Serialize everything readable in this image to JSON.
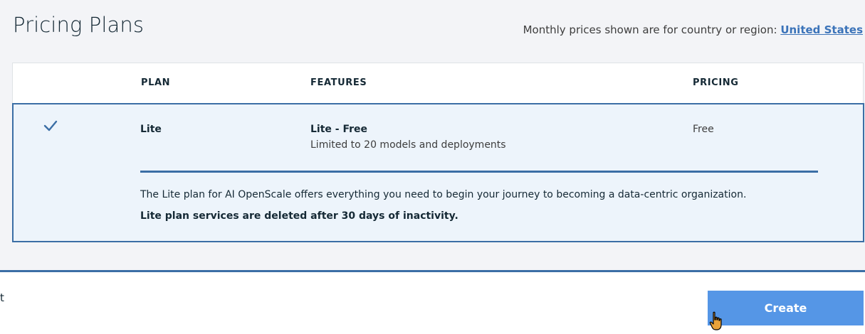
{
  "header": {
    "title": "Pricing Plans",
    "region_prefix": "Monthly prices shown are for country or region: ",
    "region_link": "United States"
  },
  "table": {
    "columns": [
      "PLAN",
      "FEATURES",
      "PRICING"
    ],
    "selected_plan": {
      "name": "Lite",
      "feature_title": "Lite - Free",
      "feature_detail": "Limited to 20 models and deployments",
      "price": "Free",
      "description": "The Lite plan for AI OpenScale offers everything you need to begin your journey to becoming a data-centric organization.",
      "inactivity_note": "Lite plan services are deleted after 30 days of inactivity."
    }
  },
  "footer": {
    "left_text": "t",
    "create_label": "Create"
  },
  "colors": {
    "accent_border": "#3b6ea5",
    "selected_row_bg": "#edf4fb",
    "create_button_bg": "#5596e6",
    "link": "#3b73b9"
  },
  "icons": [
    "checkmark-icon",
    "hand-cursor-icon"
  ]
}
